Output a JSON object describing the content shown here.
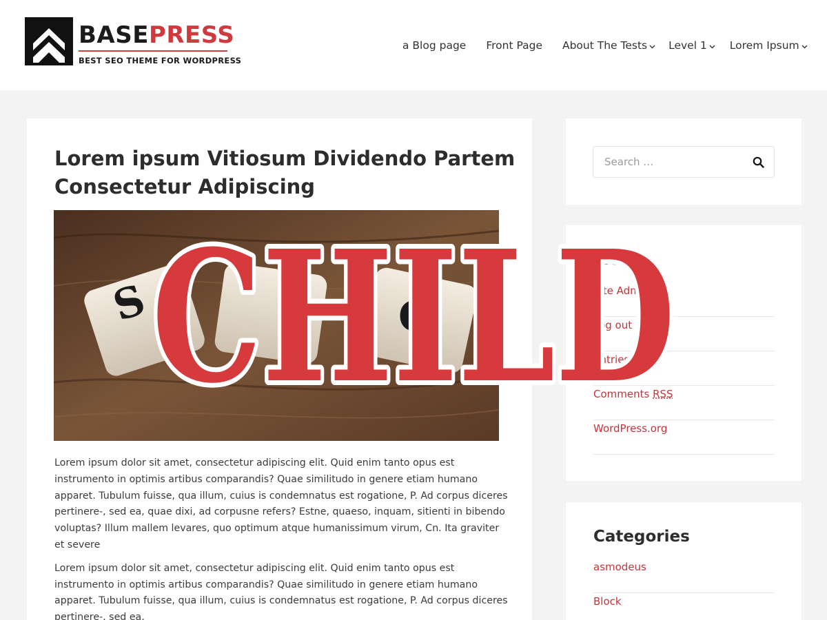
{
  "header": {
    "logo": {
      "name_part1": "BASE",
      "name_part2": "PRESS",
      "tagline": "BEST SEO THEME FOR WORDPRESS"
    },
    "nav": [
      {
        "label": "a Blog page",
        "has_dropdown": false
      },
      {
        "label": "Front Page",
        "has_dropdown": false
      },
      {
        "label": "About The Tests",
        "has_dropdown": true
      },
      {
        "label": "Level 1",
        "has_dropdown": true
      },
      {
        "label": "Lorem Ipsum",
        "has_dropdown": true
      }
    ]
  },
  "article": {
    "title": "Lorem ipsum Vitiosum Dividendo Partem Consectetur Adipiscing",
    "image_description": "Wooden dice with letters S E O on a wooden table",
    "paragraphs": [
      "Lorem ipsum dolor sit amet, consectetur adipiscing elit. Quid enim tanto opus est instrumento in optimis artibus comparandis? Quae similitudo in genere etiam humano apparet. Tubulum fuisse, qua illum, cuius is condemnatus est rogatione, P. Ad corpus diceres pertinere-, sed ea, quae dixi, ad corpusne refers? Estne, quaeso, inquam, sitienti in bibendo voluptas? Illum mallem levares, quo optimum atque humanissimum virum, Cn. Ita graviter et severe",
      "Lorem ipsum dolor sit amet, consectetur adipiscing elit. Quid enim tanto opus est instrumento in optimis artibus comparandis? Quae similitudo in genere etiam humano apparet. Tubulum fuisse, qua illum, cuius is condemnatus est rogatione, P. Ad corpus diceres pertinere-, sed ea,"
    ]
  },
  "sidebar": {
    "search": {
      "placeholder": "Search …",
      "value": ""
    },
    "meta": {
      "title": "Meta",
      "items": [
        {
          "label": "Site Admin"
        },
        {
          "label": "Log out"
        },
        {
          "label": "Entries RSS"
        },
        {
          "label": "Comments",
          "abbr": "RSS"
        },
        {
          "label": "WordPress.org"
        }
      ]
    },
    "categories": {
      "title": "Categories",
      "items": [
        {
          "label": "asmodeus"
        },
        {
          "label": "Block"
        }
      ]
    }
  },
  "overlay": {
    "stamp_text": "CHILD"
  },
  "colors": {
    "accent": "#d03a3e",
    "link": "#c5343a",
    "stamp": "#d63a3c",
    "background": "#f3f3f3"
  },
  "icons": {
    "search": "search-icon",
    "dropdown": "chevron-down-icon"
  }
}
